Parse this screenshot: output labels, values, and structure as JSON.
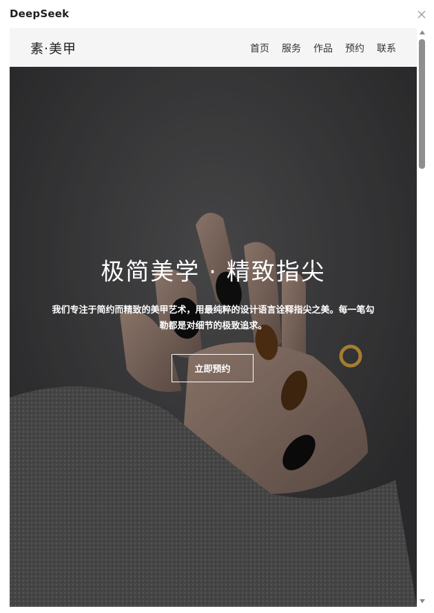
{
  "window": {
    "title": "DeepSeek",
    "close_icon": "close-icon"
  },
  "site": {
    "brand": "素·美甲",
    "nav": [
      {
        "label": "首页"
      },
      {
        "label": "服务"
      },
      {
        "label": "作品"
      },
      {
        "label": "预约"
      },
      {
        "label": "联系"
      }
    ]
  },
  "hero": {
    "title": "极简美学 · 精致指尖",
    "description": "我们专注于简约而精致的美甲艺术，用最纯粹的设计语言诠释指尖之美。每一笔勾勒都是对细节的极致追求。",
    "cta_label": "立即预约"
  },
  "colors": {
    "header_bg": "#f5f5f5",
    "hero_bg": "#3b3b3d",
    "text_light": "#ffffff"
  }
}
